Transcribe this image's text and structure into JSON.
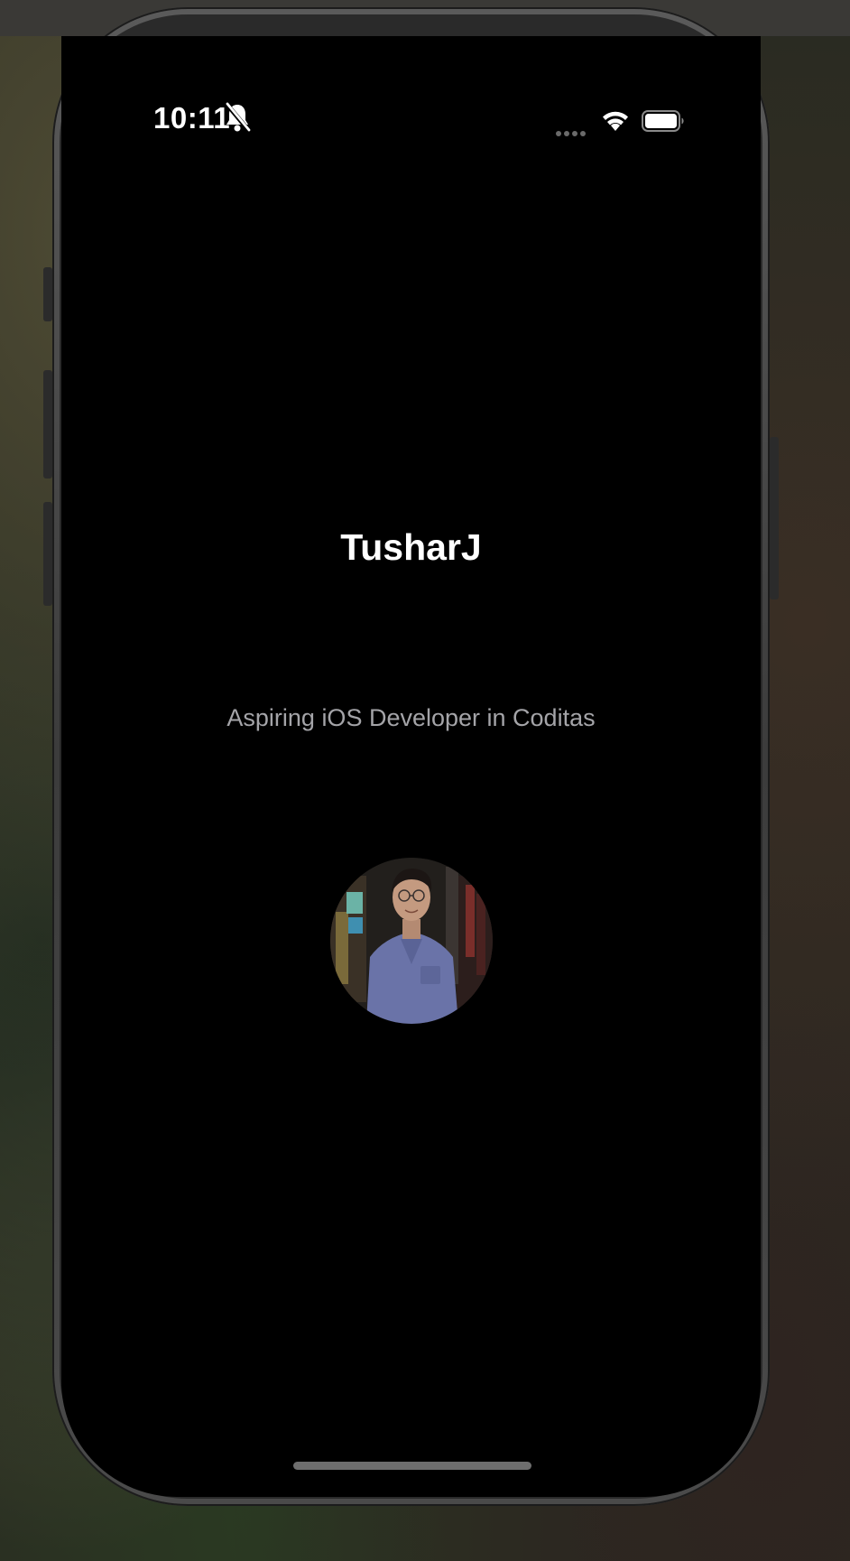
{
  "status_bar": {
    "time": "10:11",
    "icons": [
      "bell-slash-icon",
      "cellular-signal-icon",
      "wifi-icon",
      "battery-icon"
    ]
  },
  "profile": {
    "name": "TusharJ",
    "tagline": "Aspiring iOS Developer in Coditas",
    "photo": "profile-photo"
  },
  "colors": {
    "screen_background": "#000000",
    "name_text": "#ffffff",
    "tagline_text": "#a4a4a8"
  }
}
